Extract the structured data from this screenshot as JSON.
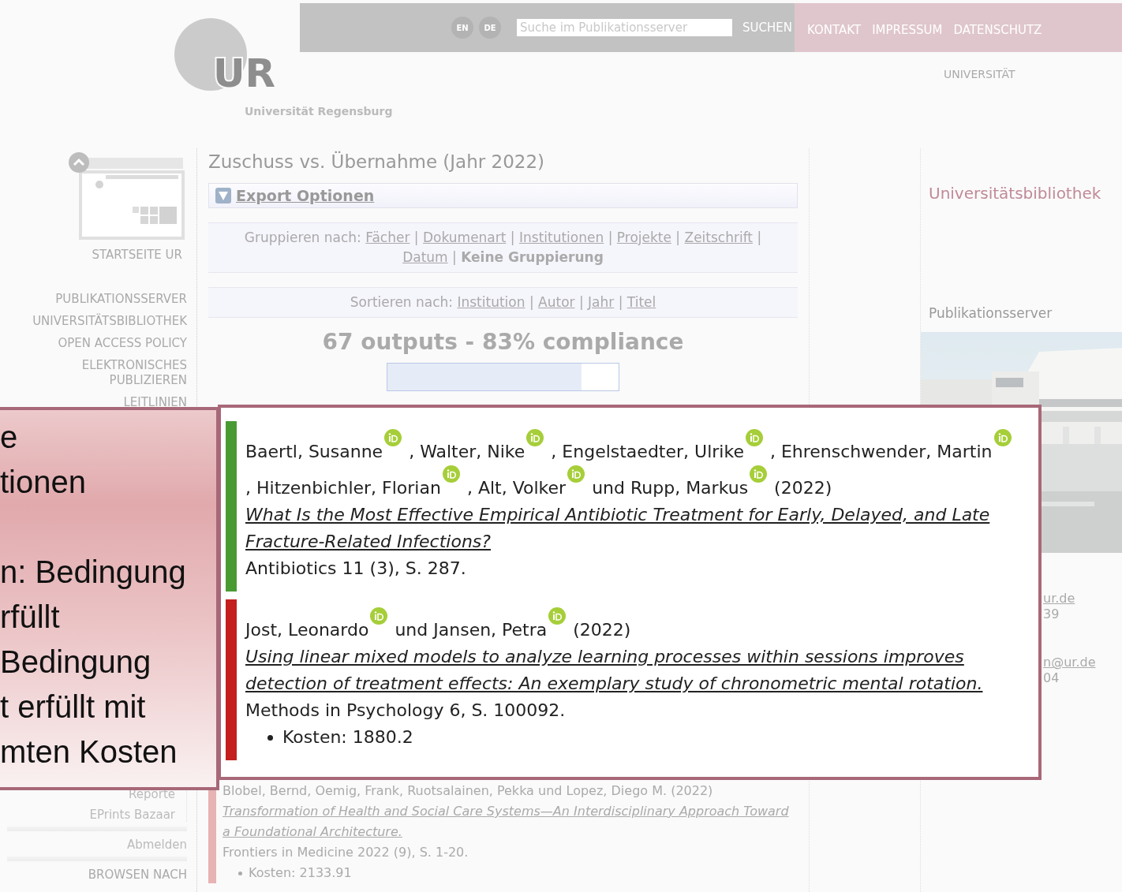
{
  "header": {
    "logo": {
      "mark": "UR",
      "subtitle": "Universität Regensburg"
    },
    "languages": [
      "EN",
      "DE"
    ],
    "search": {
      "placeholder": "Suche im Publikationsserver",
      "button": "SUCHEN"
    },
    "links": [
      "KONTAKT",
      "IMPRESSUM",
      "DATENSCHUTZ"
    ],
    "section_label": "UNIVERSITÄT"
  },
  "sidebar": {
    "home_label": "STARTSEITE UR",
    "nav": [
      "PUBLIKATIONSSERVER",
      "UNIVERSITÄTSBIBLIOTHEK",
      "OPEN ACCESS POLICY",
      "ELEKTRONISCHES PUBLIZIEREN",
      "LEITLINIEN"
    ],
    "user_menu": [
      "Reporte",
      "EPrints Bazaar"
    ],
    "logout": "Abmelden",
    "browse_heading": "BROWSEN NACH"
  },
  "main": {
    "title": "Zuschuss vs. Übernahme (Jahr 2022)",
    "export": "Export Optionen",
    "grouping": {
      "label": "Gruppieren nach:",
      "separator": "|",
      "options": [
        {
          "label": "Fächer",
          "selected": false
        },
        {
          "label": "Dokumenart",
          "selected": false
        },
        {
          "label": "Institutionen",
          "selected": false
        },
        {
          "label": "Projekte",
          "selected": false
        },
        {
          "label": "Zeitschrift",
          "selected": false
        },
        {
          "label": "Datum",
          "selected": false
        },
        {
          "label": "Keine Gruppierung",
          "selected": true
        }
      ]
    },
    "sorting": {
      "label": "Sortieren nach:",
      "separator": "|",
      "options": [
        {
          "label": "Institution",
          "selected": false
        },
        {
          "label": "Autor",
          "selected": false
        },
        {
          "label": "Jahr",
          "selected": false
        },
        {
          "label": "Titel",
          "selected": false
        }
      ]
    },
    "summary": "67 outputs - 83% compliance",
    "compliance": {
      "level": 0.84
    },
    "records": [
      {
        "compliant": false,
        "authors": [
          {
            "text": "Blobel, Bernd, Oemig, Frank, Ruotsalainen, Pekka und Lopez, Diego M.",
            "orcid": false
          }
        ],
        "year": "(2022)",
        "title": "Transformation of Health and Social Care Systems—An Interdisciplinary Approach Toward a Foundational Architecture.",
        "source": "Frontiers in Medicine 2022 (9), S. 1-20.",
        "costs": [
          "Kosten: 2133.91"
        ]
      }
    ]
  },
  "right": {
    "heading": "Universitätsbibliothek",
    "subheading": "Publikationsserver",
    "contacts": [
      {
        "text": "ur.de",
        "kind": "link"
      },
      {
        "text": "39",
        "kind": "text"
      },
      {
        "text": "n@ur.de",
        "kind": "link"
      },
      {
        "text": "04",
        "kind": "text"
      }
    ]
  },
  "highlight": {
    "records": [
      {
        "compliant": true,
        "authors": [
          {
            "text": "Baertl, Susanne",
            "orcid": true
          },
          {
            "text": ", Walter, Nike",
            "orcid": true
          },
          {
            "text": ", Engelstaedter, Ulrike",
            "orcid": true
          },
          {
            "text": ", Ehrenschwender, Martin",
            "orcid": true
          },
          {
            "text": ", Hitzenbichler, Florian",
            "orcid": true
          },
          {
            "text": ", Alt, Volker",
            "orcid": true
          },
          {
            "text": "und Rupp, Markus",
            "orcid": true
          }
        ],
        "year": "(2022)",
        "title": "What Is the Most Effective Empirical Antibiotic Treatment for Early, Delayed, and Late Fracture-Related Infections?",
        "source": "Antibiotics 11 (3), S. 287."
      },
      {
        "compliant": false,
        "authors": [
          {
            "text": "Jost, Leonardo",
            "orcid": true
          },
          {
            "text": "und Jansen, Petra",
            "orcid": true
          }
        ],
        "year": "(2022)",
        "title": "Using linear mixed models to analyze learning processes within sessions improves detection of treatment effects: An exemplary study of chronometric mental rotation.",
        "source": "Methods in Psychology 6, S. 100092.",
        "costs": [
          "Kosten: 1880.2"
        ]
      }
    ]
  },
  "callout": {
    "paragraphs": [
      [
        "e",
        "tionen"
      ],
      [
        "n: Bedingung",
        "rfüllt",
        "Bedingung",
        "t erfüllt mit",
        "mten Kosten"
      ]
    ]
  }
}
